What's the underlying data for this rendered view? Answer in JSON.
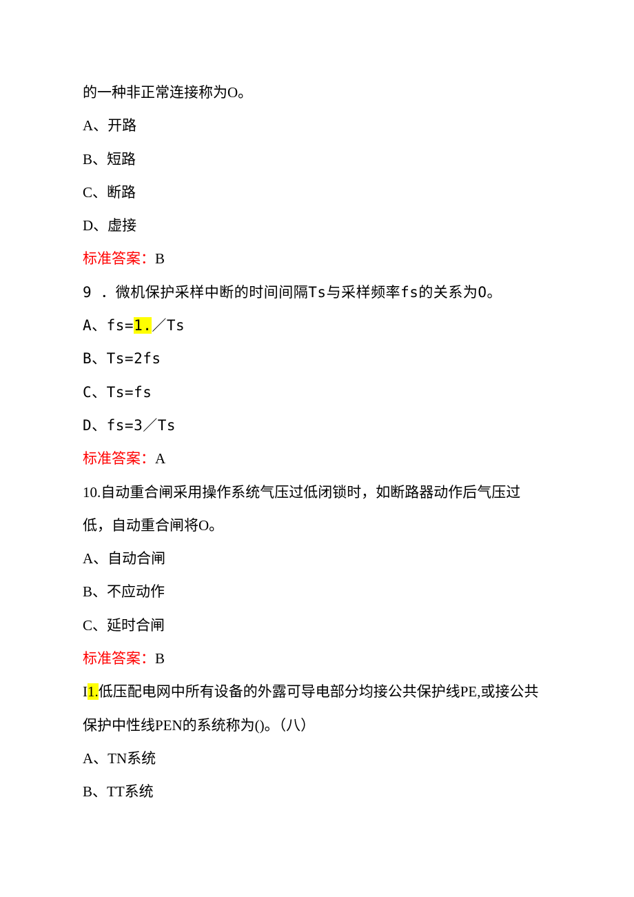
{
  "q8_tail": "的一种非正常连接称为O。",
  "q8_a": "A、开路",
  "q8_b": "B、短路",
  "q8_c": "C、断路",
  "q8_d": "D、虚接",
  "q8_answer_label": "标准答案：",
  "q8_answer_val": "B",
  "q9_stem": "9 ．微机保护采样中断的时间间隔Ts与采样频率fs的关系为O。",
  "q9_a_prefix": "A、fs=",
  "q9_a_hl": "1.",
  "q9_a_suffix": "／Ts",
  "q9_b": "B、Ts=2fs",
  "q9_c": "C、Ts=fs",
  "q9_d": "D、fs=3／Ts",
  "q9_answer_label": "标准答案：",
  "q9_answer_val": "A",
  "q10_stem_l1": "10.自动重合闸采用操作系统气压过低闭锁时，如断路器动作后气压过",
  "q10_stem_l2": "低，自动重合闸将O。",
  "q10_a": "A、自动合闸",
  "q10_b": "B、不应动作",
  "q10_c": "C、延时合闸",
  "q10_answer_label": "标准答案：",
  "q10_answer_val": "B",
  "q11_prefix": "I",
  "q11_hl": "1.",
  "q11_suffix": "低压配电网中所有设备的外露可导电部分均接公共保护线PE,或接公共",
  "q11_stem_l2": "保护中性线PEN的系统称为()。（八）",
  "q11_a": "A、TN系统",
  "q11_b": "B、TT系统"
}
